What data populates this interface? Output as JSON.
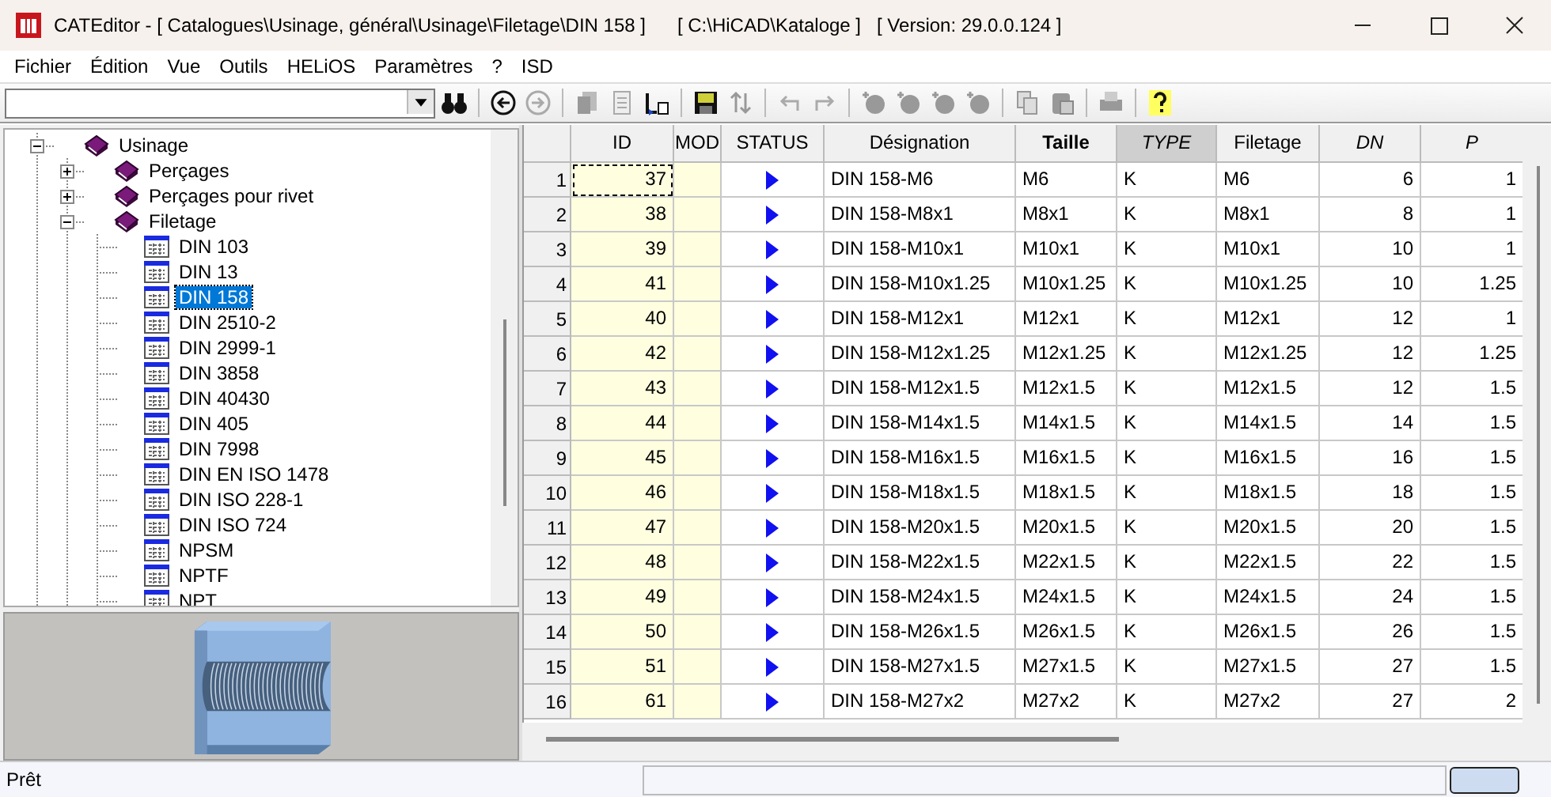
{
  "window": {
    "title": "CATEditor - [ Catalogues\\Usinage, général\\Usinage\\Filetage\\DIN 158 ]",
    "path": "[ C:\\HiCAD\\Kataloge ]",
    "version": "[ Version: 29.0.0.124 ]"
  },
  "menu": [
    "Fichier",
    "Édition",
    "Vue",
    "Outils",
    "HELiOS",
    "Paramètres",
    "?",
    "ISD"
  ],
  "tree": [
    {
      "label": "Usinage",
      "kind": "folder",
      "expanded": true,
      "selected": false,
      "children": [
        {
          "label": "Perçages",
          "kind": "folder",
          "expanded": false,
          "selected": false
        },
        {
          "label": "Perçages pour rivet",
          "kind": "folder",
          "expanded": false,
          "selected": false
        },
        {
          "label": "Filetage",
          "kind": "folder",
          "expanded": true,
          "selected": false,
          "children": [
            {
              "label": "DIN 103",
              "kind": "table",
              "selected": false
            },
            {
              "label": "DIN 13",
              "kind": "table",
              "selected": false
            },
            {
              "label": "DIN 158",
              "kind": "table",
              "selected": true
            },
            {
              "label": "DIN 2510-2",
              "kind": "table",
              "selected": false
            },
            {
              "label": "DIN 2999-1",
              "kind": "table",
              "selected": false
            },
            {
              "label": "DIN 3858",
              "kind": "table",
              "selected": false
            },
            {
              "label": "DIN 40430",
              "kind": "table",
              "selected": false
            },
            {
              "label": "DIN 405",
              "kind": "table",
              "selected": false
            },
            {
              "label": "DIN 7998",
              "kind": "table",
              "selected": false
            },
            {
              "label": "DIN EN ISO 1478",
              "kind": "table",
              "selected": false
            },
            {
              "label": "DIN ISO 228-1",
              "kind": "table",
              "selected": false
            },
            {
              "label": "DIN ISO 724",
              "kind": "table",
              "selected": false
            },
            {
              "label": "NPSM",
              "kind": "table",
              "selected": false
            },
            {
              "label": "NPTF",
              "kind": "table",
              "selected": false
            },
            {
              "label": "NPT",
              "kind": "table",
              "selected": false
            }
          ]
        }
      ]
    }
  ],
  "table": {
    "columns": [
      {
        "label": "ID",
        "selected": false
      },
      {
        "label": "MOD",
        "selected": false
      },
      {
        "label": "STATUS",
        "selected": false
      },
      {
        "label": "Désignation",
        "selected": false
      },
      {
        "label": "Taille",
        "selected": false
      },
      {
        "label": "TYPE",
        "selected": true
      },
      {
        "label": "Filetage",
        "selected": false
      },
      {
        "label": "DN",
        "selected": false
      },
      {
        "label": "P",
        "selected": false
      }
    ],
    "rows": [
      {
        "num": "1",
        "id": "37",
        "designation": "DIN 158-M6",
        "taille": "M6",
        "type": "K",
        "filetage": "M6",
        "dn": "6",
        "p": "1",
        "selected": true
      },
      {
        "num": "2",
        "id": "38",
        "designation": "DIN 158-M8x1",
        "taille": "M8x1",
        "type": "K",
        "filetage": "M8x1",
        "dn": "8",
        "p": "1",
        "selected": false
      },
      {
        "num": "3",
        "id": "39",
        "designation": "DIN 158-M10x1",
        "taille": "M10x1",
        "type": "K",
        "filetage": "M10x1",
        "dn": "10",
        "p": "1",
        "selected": false
      },
      {
        "num": "4",
        "id": "41",
        "designation": "DIN 158-M10x1.25",
        "taille": "M10x1.25",
        "type": "K",
        "filetage": "M10x1.25",
        "dn": "10",
        "p": "1.25",
        "selected": false
      },
      {
        "num": "5",
        "id": "40",
        "designation": "DIN 158-M12x1",
        "taille": "M12x1",
        "type": "K",
        "filetage": "M12x1",
        "dn": "12",
        "p": "1",
        "selected": false
      },
      {
        "num": "6",
        "id": "42",
        "designation": "DIN 158-M12x1.25",
        "taille": "M12x1.25",
        "type": "K",
        "filetage": "M12x1.25",
        "dn": "12",
        "p": "1.25",
        "selected": false
      },
      {
        "num": "7",
        "id": "43",
        "designation": "DIN 158-M12x1.5",
        "taille": "M12x1.5",
        "type": "K",
        "filetage": "M12x1.5",
        "dn": "12",
        "p": "1.5",
        "selected": false
      },
      {
        "num": "8",
        "id": "44",
        "designation": "DIN 158-M14x1.5",
        "taille": "M14x1.5",
        "type": "K",
        "filetage": "M14x1.5",
        "dn": "14",
        "p": "1.5",
        "selected": false
      },
      {
        "num": "9",
        "id": "45",
        "designation": "DIN 158-M16x1.5",
        "taille": "M16x1.5",
        "type": "K",
        "filetage": "M16x1.5",
        "dn": "16",
        "p": "1.5",
        "selected": false
      },
      {
        "num": "10",
        "id": "46",
        "designation": "DIN 158-M18x1.5",
        "taille": "M18x1.5",
        "type": "K",
        "filetage": "M18x1.5",
        "dn": "18",
        "p": "1.5",
        "selected": false
      },
      {
        "num": "11",
        "id": "47",
        "designation": "DIN 158-M20x1.5",
        "taille": "M20x1.5",
        "type": "K",
        "filetage": "M20x1.5",
        "dn": "20",
        "p": "1.5",
        "selected": false
      },
      {
        "num": "12",
        "id": "48",
        "designation": "DIN 158-M22x1.5",
        "taille": "M22x1.5",
        "type": "K",
        "filetage": "M22x1.5",
        "dn": "22",
        "p": "1.5",
        "selected": false
      },
      {
        "num": "13",
        "id": "49",
        "designation": "DIN 158-M24x1.5",
        "taille": "M24x1.5",
        "type": "K",
        "filetage": "M24x1.5",
        "dn": "24",
        "p": "1.5",
        "selected": false
      },
      {
        "num": "14",
        "id": "50",
        "designation": "DIN 158-M26x1.5",
        "taille": "M26x1.5",
        "type": "K",
        "filetage": "M26x1.5",
        "dn": "26",
        "p": "1.5",
        "selected": false
      },
      {
        "num": "15",
        "id": "51",
        "designation": "DIN 158-M27x1.5",
        "taille": "M27x1.5",
        "type": "K",
        "filetage": "M27x1.5",
        "dn": "27",
        "p": "1.5",
        "selected": false
      },
      {
        "num": "16",
        "id": "61",
        "designation": "DIN 158-M27x2",
        "taille": "M27x2",
        "type": "K",
        "filetage": "M27x2",
        "dn": "27",
        "p": "2",
        "selected": false
      }
    ]
  },
  "status_bar": {
    "text": "Prêt"
  }
}
